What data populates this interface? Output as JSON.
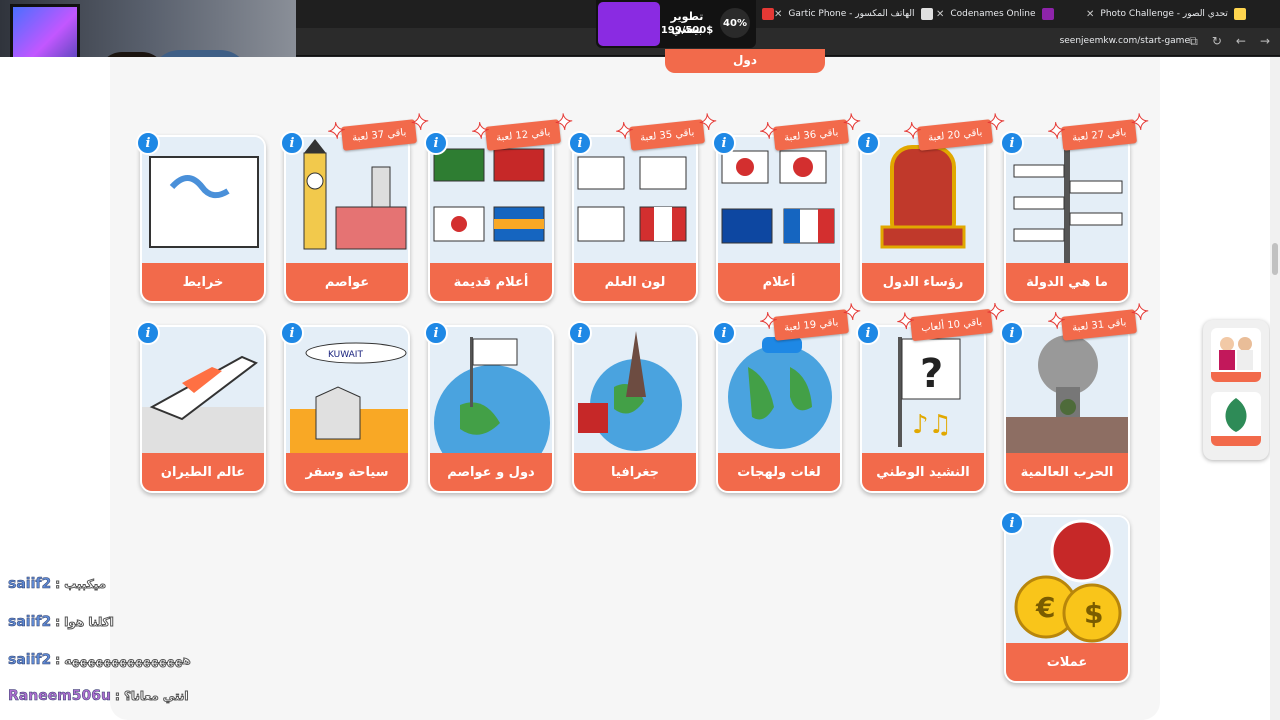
{
  "browser": {
    "tabs": [
      {
        "label": "Photo Challenge - تحدي الصور",
        "color": "#ffd54f"
      },
      {
        "label": "Codenames Online",
        "color": "#8e24aa"
      },
      {
        "label": "Gartic Phone - الهاتف المكسور",
        "color": "#e0e0e0"
      }
    ],
    "url": "seenjeemkw.com/start-game"
  },
  "donation": {
    "title": "تطوير بيسي",
    "amount": "199/500$",
    "percent": "40%",
    "progress_fraction": 0.4
  },
  "page": {
    "top_pill": "دول"
  },
  "cards": [
    {
      "title": "ما هي الدولة",
      "badge": "باقي 27 لعبة",
      "icon": "signpost-art"
    },
    {
      "title": "رؤساء الدول",
      "badge": "باقي 20 لعبة",
      "icon": "throne-art"
    },
    {
      "title": "أعلام",
      "badge": "باقي 36 لعبة",
      "icon": "flags-art"
    },
    {
      "title": "لون العلم",
      "badge": "باقي 35 لعبة",
      "icon": "blank-flags-art"
    },
    {
      "title": "أعلام قديمة",
      "badge": "باقي 12 لعبة",
      "icon": "old-flags-art"
    },
    {
      "title": "عواصم",
      "badge": "باقي 37 لعبة",
      "icon": "landmarks-art"
    },
    {
      "title": "خرايط",
      "badge": "",
      "icon": "map-art"
    },
    {
      "title": "الحرب العالمية",
      "badge": "باقي 31 لعبة",
      "icon": "war-art"
    },
    {
      "title": "النشيد الوطني",
      "badge": "باقي 10 ألعاب",
      "icon": "anthem-art"
    },
    {
      "title": "لغات ولهجات",
      "badge": "باقي 19 لعبة",
      "icon": "globe-languages-art"
    },
    {
      "title": "جغرافيا",
      "badge": "",
      "icon": "geography-art"
    },
    {
      "title": "دول و عواصم",
      "badge": "",
      "icon": "globe-flag-art"
    },
    {
      "title": "سياحة وسفر",
      "badge": "",
      "icon": "travel-art"
    },
    {
      "title": "عالم الطيران",
      "badge": "",
      "icon": "plane-art"
    },
    {
      "title": "عملات",
      "badge": "",
      "icon": "coins-art"
    }
  ],
  "chat": [
    {
      "user": "saiif2",
      "msg": ": ميكببب"
    },
    {
      "user": "saiif2",
      "msg": ": اكلنا هوا"
    },
    {
      "user": "saiif2",
      "msg": ": هههههههههههههههه"
    },
    {
      "user": "Raneem506u",
      "msg": ": انتي معانا؟"
    }
  ]
}
